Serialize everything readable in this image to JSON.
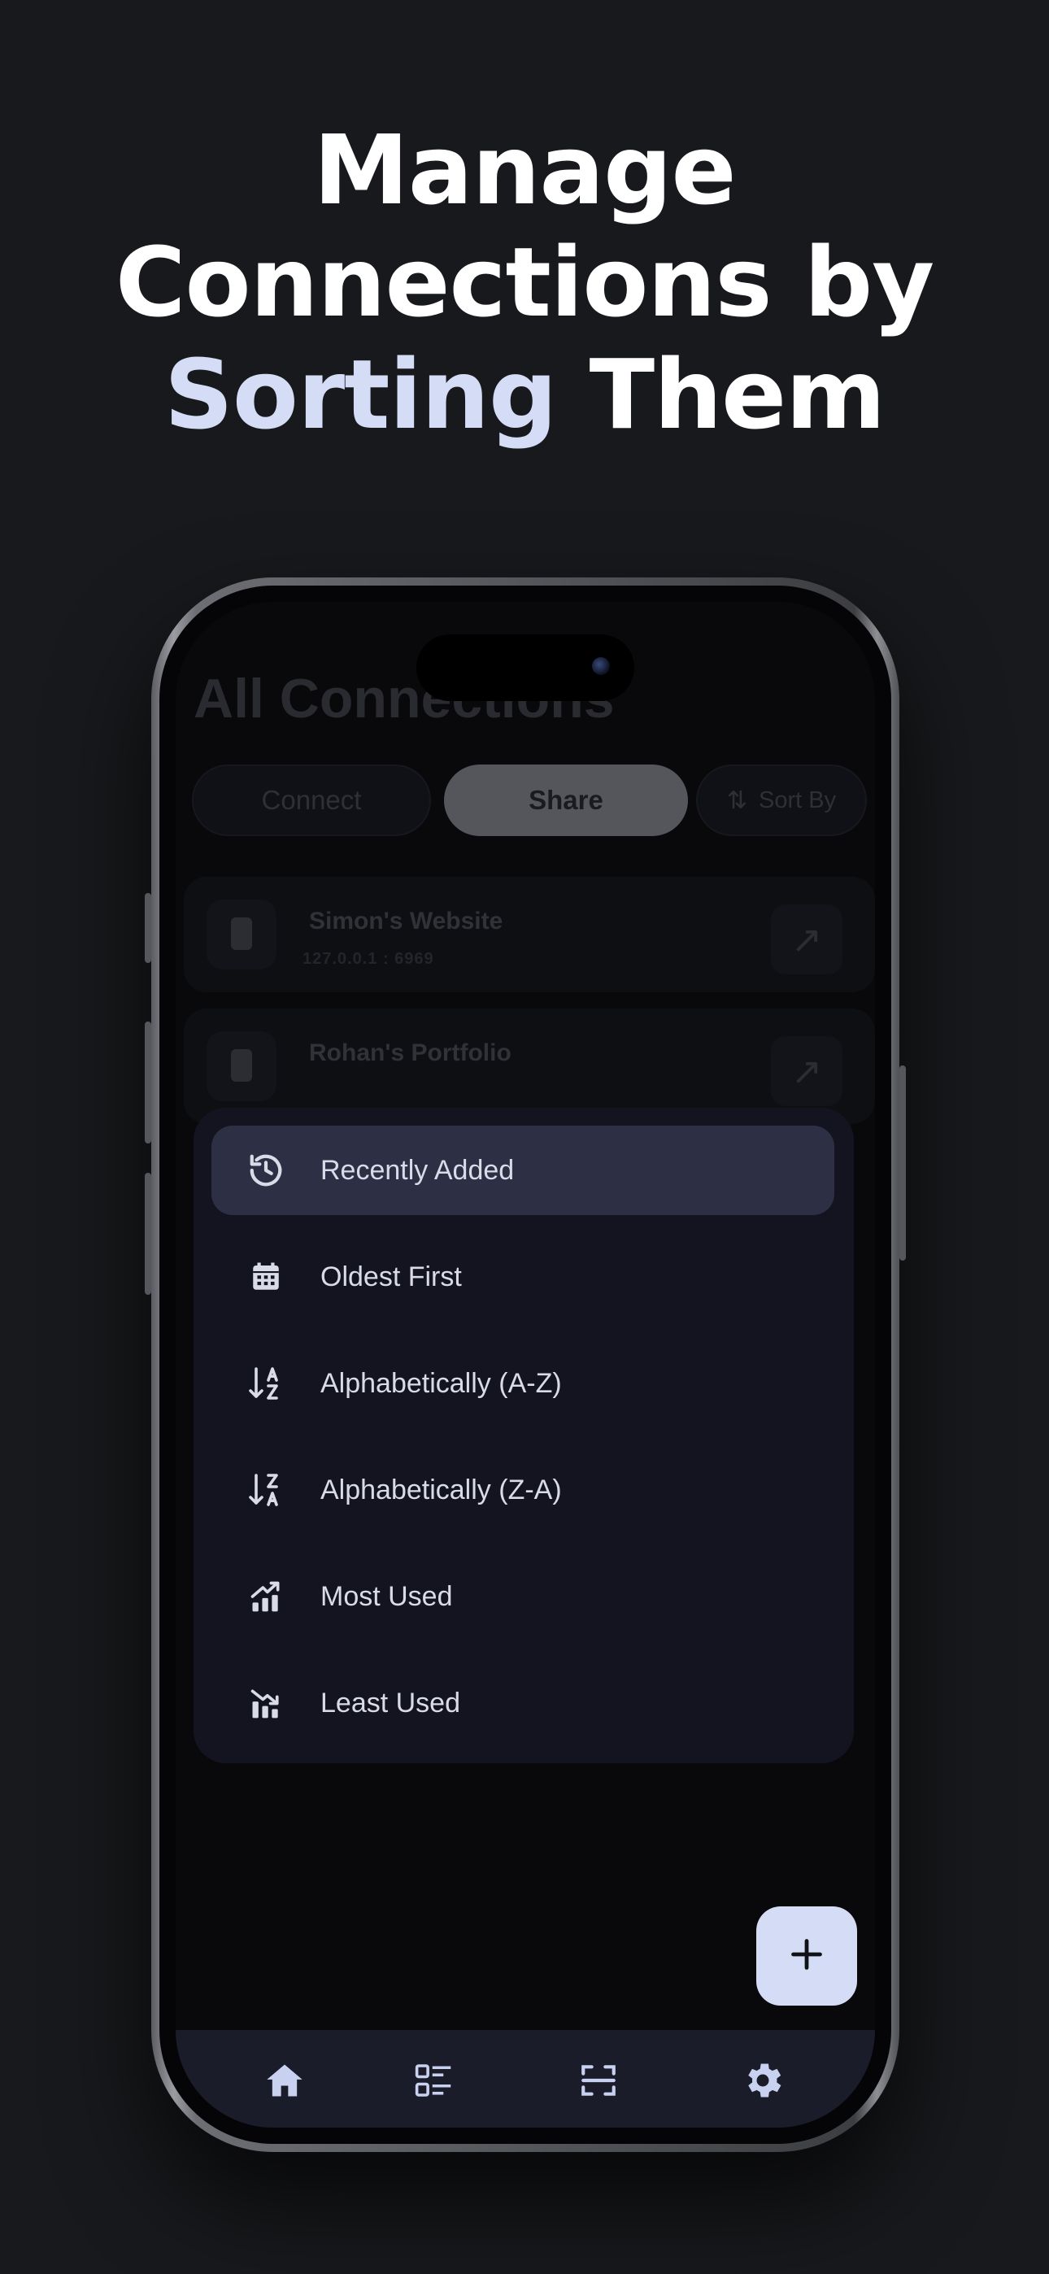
{
  "headline": {
    "line1": "Manage",
    "line2": "Connections by",
    "accent": "Sorting",
    "line3_rest": " Them"
  },
  "screen": {
    "title": "All Connections",
    "tabs": {
      "connect": "Connect",
      "share": "Share",
      "selected": "Share"
    },
    "sort_button": "Sort By",
    "connections": [
      {
        "name": "Simon's Website",
        "address": "127.0.0.1 : 6969"
      },
      {
        "name": "Rohan's Portfolio"
      }
    ],
    "sort_menu": {
      "selected": "Recently Added",
      "options": [
        {
          "label": "Recently Added",
          "icon": "history-icon"
        },
        {
          "label": "Oldest First",
          "icon": "calendar-icon"
        },
        {
          "label": "Alphabetically (A-Z)",
          "icon": "sort-alpha-asc-icon"
        },
        {
          "label": "Alphabetically (Z-A)",
          "icon": "sort-alpha-desc-icon"
        },
        {
          "label": "Most Used",
          "icon": "trending-up-chart-icon"
        },
        {
          "label": "Least Used",
          "icon": "trending-down-chart-icon"
        }
      ]
    },
    "fab_icon": "plus-icon",
    "nav": [
      "home-icon",
      "list-icon",
      "scan-icon",
      "settings-icon"
    ]
  },
  "colors": {
    "background": "#18191c",
    "accent": "#d4dcf6",
    "sheet": "#131420",
    "selected_option": "#2d2f45"
  }
}
